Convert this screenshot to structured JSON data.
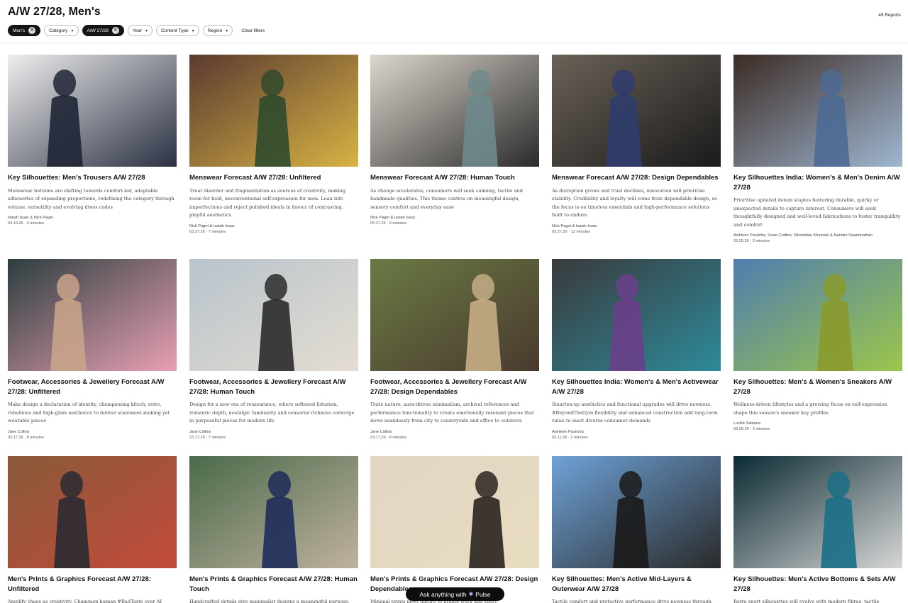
{
  "header": {
    "title": "A/W 27/28, Men's",
    "report_count": "49 Reports",
    "filters": [
      {
        "label": "Men's",
        "active": true
      },
      {
        "label": "Category",
        "active": false
      },
      {
        "label": "A/W 27/28",
        "active": true
      },
      {
        "label": "Year",
        "active": false
      },
      {
        "label": "Content Type",
        "active": false
      },
      {
        "label": "Region",
        "active": false
      }
    ],
    "clear_label": "Clear filters"
  },
  "cards": [
    {
      "title": "Key Silhouettes: Men's Trousers A/W 27/28",
      "desc": "Menswear bottoms are shifting towards comfort-led, adaptable silhouettes of expanding proportions, redefining the category through volume, versatility and evolving dress codes",
      "author": "Isaiah Isaac & Nick Paget",
      "meta": "04.10.26 · 4 minutes",
      "palette": [
        "#eeeeee",
        "#1f2535",
        "#2a3042"
      ]
    },
    {
      "title": "Menswear Forecast A/W 27/28: Unfiltered",
      "desc": "Treat disorder and fragmentation as sources of creativity, making room for bold, unconventional self-expression for men. Lean into imperfections and reject polished ideals in favour of contrasting, playful aesthetics",
      "author": "Nick Paget & Isaiah Isaac",
      "meta": "03.27.26 · 7 minutes",
      "palette": [
        "#5a3a30",
        "#2f4a2c",
        "#d8b344"
      ]
    },
    {
      "title": "Menswear Forecast A/W 27/28: Human Touch",
      "desc": "As change accelerates, consumers will seek calming, tactile and handmade qualities. This theme centres on meaningful design, sensory comfort and everyday ease",
      "author": "Nick Paget & Isaiah Isaac",
      "meta": "03.27.26 · 9 minutes",
      "palette": [
        "#ddd7cd",
        "#6f8a8c",
        "#2b2b2b"
      ]
    },
    {
      "title": "Menswear Forecast A/W 27/28: Design Dependables",
      "desc": "As disruption grows and trust declines, innovation will prioritise stability. Credibility and loyalty will come from dependable design, so the focus is on timeless essentials and high-performance solutions built to endure",
      "author": "Nick Paget & Isaiah Isaac",
      "meta": "03.27.26 · 12 minutes",
      "palette": [
        "#6b6258",
        "#2f3c6e",
        "#1a1a1a"
      ]
    },
    {
      "title": "Key Silhouettes India: Women's & Men's Denim A/W 27/28",
      "desc": "Prioritise updated denim staples featuring durable, quirky or unexpected details to capture interest. Consumers will seek thoughtfully designed and well-loved fabrications to foster tranquillity and comfort",
      "author": "Aishleen Pasricha, Susie Crafton, Sthandiwe Khumalo & Nandini Swaminathan",
      "meta": "03.20.26 · 2 minutes",
      "palette": [
        "#3b2b24",
        "#4d6a93",
        "#9fb6d1"
      ]
    },
    {
      "title": "Footwear, Accessories & Jewellery Forecast A/W 27/28: Unfiltered",
      "desc": "Make design a declaration of identity, championing kitsch, retro, rebellious and high-glam aesthetics to deliver statement-making yet wearable pieces",
      "author": "Jane Collins",
      "meta": "03.17.26 · 8 minutes",
      "palette": [
        "#2c3e3f",
        "#c9a38a",
        "#e8a0b3"
      ]
    },
    {
      "title": "Footwear, Accessories & Jewellery Forecast A/W 27/28: Human Touch",
      "desc": "Design for a new era of reassurance, where softened futurism, romantic depth, nostalgic familiarity and sensorial richness converge in purposeful pieces for modern life",
      "author": "Jane Collins",
      "meta": "03.17.26 · 7 minutes",
      "palette": [
        "#b8c3cc",
        "#2a2a2a",
        "#e4ddd2"
      ]
    },
    {
      "title": "Footwear, Accessories & Jewellery Forecast A/W 27/28: Design Dependables",
      "desc": "Unite nature, aura-driven minimalism, archival references and performance functionality to create emotionally resonant pieces that move seamlessly from city to countryside and office to outdoors",
      "author": "Jane Collins",
      "meta": "03.17.26 · 8 minutes",
      "palette": [
        "#6a7a44",
        "#c7ad86",
        "#4a3a2e"
      ]
    },
    {
      "title": "Key Silhouettes India: Women's & Men's Activewear A/W 27/28",
      "desc": "Smarten-up aesthetics and functional upgrades will drive newness. #BeyondTheGym flexibility and enhanced construction add long-term value to meet diverse consumer demands",
      "author": "Aishleen Pasricha",
      "meta": "03.11.26 · 2 minutes",
      "palette": [
        "#3a3a3c",
        "#6a3f8a",
        "#2d8a9a"
      ]
    },
    {
      "title": "Key Silhouettes: Men's & Women's Sneakers A/W 27/28",
      "desc": "Wellness-driven lifestyles and a growing focus on self-expression shape this season's sneaker key profiles",
      "author": "Lucille Saldana",
      "meta": "03.26.26 · 2 minutes",
      "palette": [
        "#4f7db0",
        "#8a9a2c",
        "#9cc64a"
      ]
    },
    {
      "title": "Men's Prints & Graphics Forecast A/W 27/28: Unfiltered",
      "desc": "Amplify chaos as creativity. Champion human #BadTaste over AI",
      "author": "",
      "meta": "",
      "palette": [
        "#8a5a3a",
        "#2a2a32",
        "#c24a3a"
      ]
    },
    {
      "title": "Men's Prints & Graphics Forecast A/W 27/28: Human Touch",
      "desc": "Handcrafted details give maximalist designs a meaningful purpose.",
      "author": "",
      "meta": "",
      "palette": [
        "#4a6a4a",
        "#1e2c5a",
        "#c0b0a0"
      ]
    },
    {
      "title": "Men's Prints & Graphics Forecast A/W 27/28: Design Dependables",
      "desc": "Minimal prints meet nature to bridge work and sport.",
      "author": "",
      "meta": "",
      "palette": [
        "#e2d5c4",
        "#2a2420",
        "#e8dcc0"
      ]
    },
    {
      "title": "Key Silhouettes: Men's Active Mid-Layers & Outerwear A/W 27/28",
      "desc": "Tactile comfort and protective performance drive newness through",
      "author": "",
      "meta": "",
      "palette": [
        "#6ea2d8",
        "#1a1a1a",
        "#2a2a2a"
      ]
    },
    {
      "title": "Key Silhouettes: Men's Active Bottoms & Sets A/W 27/28",
      "desc": "Retro sport silhouettes will evolve with modern fibres, tactile",
      "author": "",
      "meta": "",
      "palette": [
        "#0b2a33",
        "#1a6f86",
        "#d6d6d6"
      ]
    }
  ],
  "pulse": {
    "label": "Ask anything with",
    "brand": "Pulse",
    "icon": "sparkle-icon"
  }
}
